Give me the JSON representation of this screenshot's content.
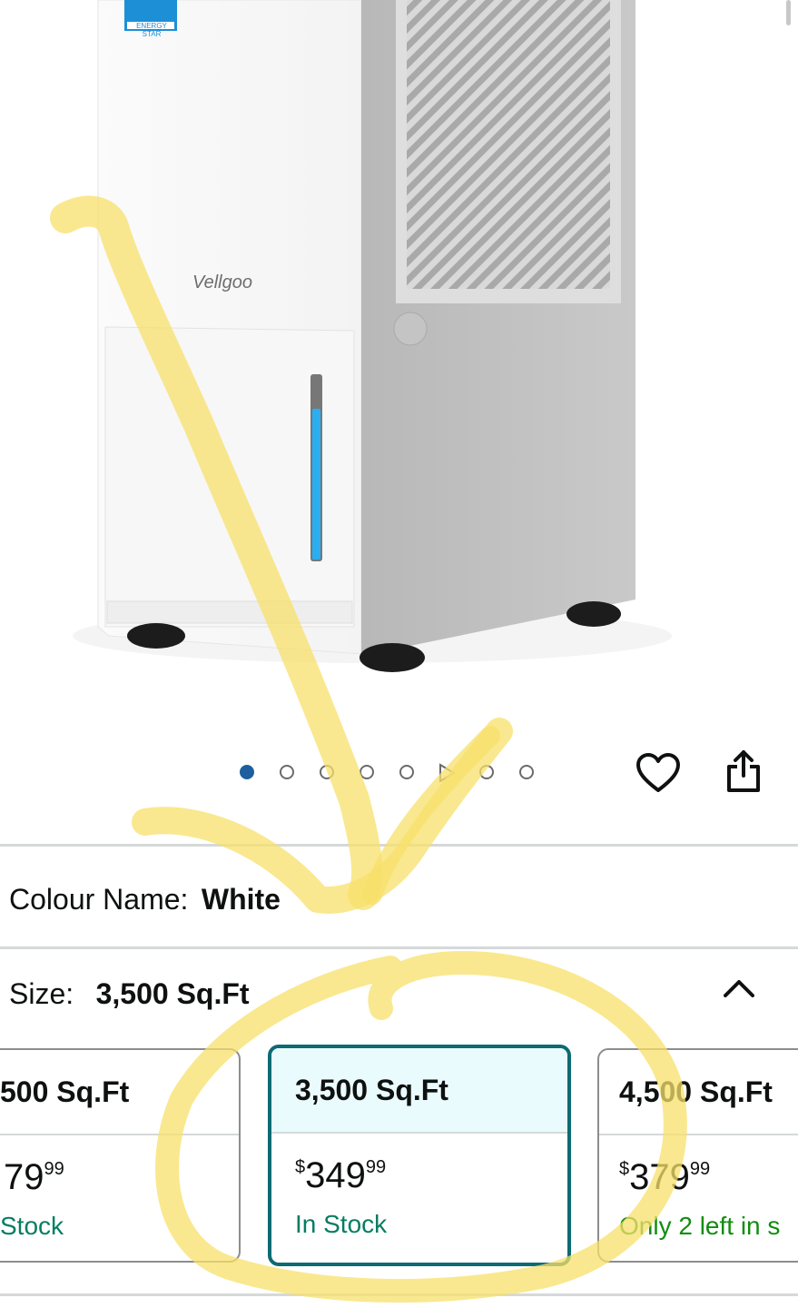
{
  "product": {
    "brand_logo": "Vellgoo",
    "badge": "ENERGY STAR"
  },
  "carousel": {
    "total": 8,
    "active_index": 0,
    "video_index": 5
  },
  "actions": {
    "wishlist_icon": "heart-icon",
    "share_icon": "share-icon"
  },
  "colour": {
    "label": "Colour Name:",
    "value": "White"
  },
  "size": {
    "label": "Size:",
    "value": "3,500 Sq.Ft",
    "toggle_icon": "chevron-up-icon",
    "options": [
      {
        "title": "500 Sq.Ft",
        "price_main": "79",
        "price_cents": "99",
        "stock": "Stock"
      },
      {
        "title": "3,500 Sq.Ft",
        "currency": "$",
        "price_main": "349",
        "price_cents": "99",
        "stock": "In Stock"
      },
      {
        "title": "4,500 Sq.Ft",
        "currency": "$",
        "price_main": "379",
        "price_cents": "99",
        "stock": "Only 2 left in s"
      }
    ]
  },
  "colors": {
    "accent": "#0c6b73",
    "selected_bg": "#eafbfd",
    "stock_green": "#067d62",
    "dot_active": "#1f5fa0",
    "annotation": "#f7e06a"
  }
}
